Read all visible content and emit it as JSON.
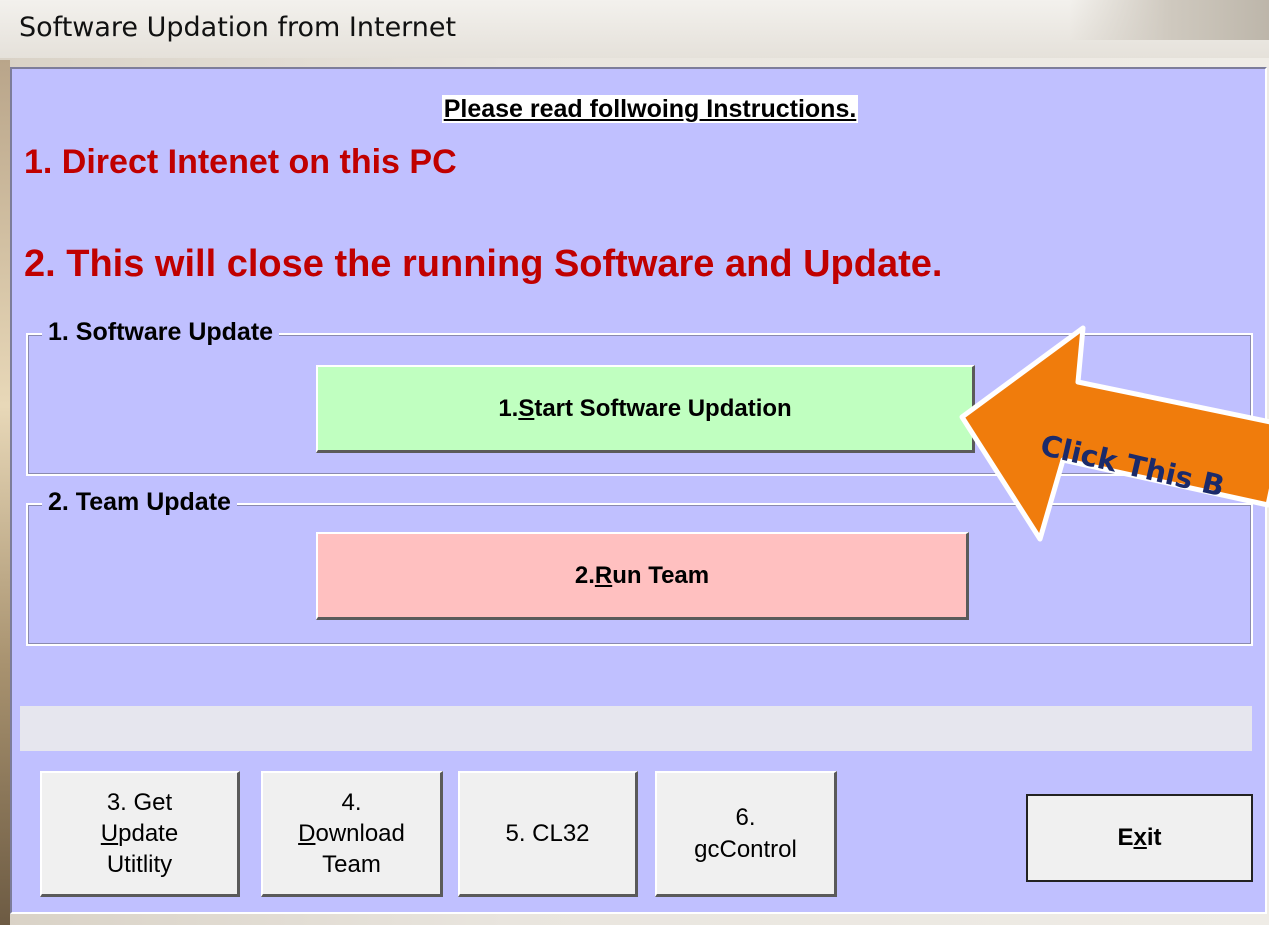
{
  "window": {
    "title": "Software Updation from Internet"
  },
  "instructions": {
    "heading": "Please read follwoing Instructions.",
    "line1": "1. Direct Intenet on this PC",
    "line2": "2. This will close the running Software and Update."
  },
  "groups": {
    "software_update": {
      "label": "1. Software Update",
      "button": {
        "prefix": "1. ",
        "mnemonic": "S",
        "rest": "tart Software Updation"
      }
    },
    "team_update": {
      "label": "2. Team Update",
      "button": {
        "prefix": "2. ",
        "mnemonic": "R",
        "rest": "un Team"
      }
    }
  },
  "bottom_buttons": {
    "get_update": {
      "line1": "3. Get",
      "mnemonic": "U",
      "line2_rest": "pdate",
      "line3": "Utitlity"
    },
    "download_team": {
      "line1": "4.",
      "mnemonic": "D",
      "line2_rest": "ownload",
      "line3": "Team"
    },
    "cl32": {
      "label": "5. CL32"
    },
    "gccontrol": {
      "line1": "6.",
      "line2": "gcControl"
    },
    "exit": {
      "pre": "E",
      "mnemonic": "x",
      "post": "it"
    }
  },
  "callout": {
    "text": "Click This B",
    "color": "#f07c0c"
  },
  "colors": {
    "client_bg": "#c0c0ff",
    "instruction_red": "#c00000",
    "green_button": "#c0ffc0",
    "red_button": "#ffc0c0"
  }
}
